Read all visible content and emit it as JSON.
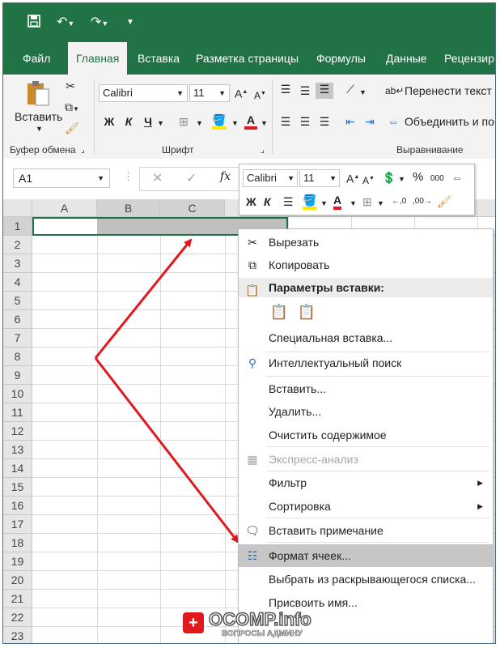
{
  "qat": {
    "save_icon": "save-icon",
    "undo_icon": "undo-icon",
    "redo_icon": "redo-icon"
  },
  "tabs": [
    "Файл",
    "Главная",
    "Вставка",
    "Разметка страницы",
    "Формулы",
    "Данные",
    "Рецензир"
  ],
  "ribbon": {
    "clipboard": {
      "paste_label": "Вставить",
      "group_label": "Буфер обмена"
    },
    "font": {
      "name": "Calibri",
      "size": "11",
      "bold": "Ж",
      "italic": "К",
      "underline": "Ч",
      "group_label": "Шрифт"
    },
    "alignment": {
      "wrap_text": "Перенести текст",
      "merge": "Объединить и по",
      "group_label": "Выравнивание"
    }
  },
  "formula_bar": {
    "name_box": "A1",
    "fx": "fx"
  },
  "mini_toolbar": {
    "font": "Calibri",
    "size": "11",
    "percent": "%",
    "thousands": "000",
    "bold": "Ж",
    "italic": "К"
  },
  "columns": [
    "A",
    "B",
    "C"
  ],
  "rows": [
    "1",
    "2",
    "3",
    "4",
    "5",
    "6",
    "7",
    "8",
    "9",
    "10",
    "11",
    "12",
    "13",
    "14",
    "15",
    "16",
    "17",
    "18",
    "19",
    "20",
    "21",
    "22",
    "23"
  ],
  "context_menu": {
    "cut": "Вырезать",
    "copy": "Копировать",
    "paste_options": "Параметры вставки:",
    "paste_special": "Специальная вставка...",
    "smart_lookup": "Интеллектуальный поиск",
    "insert": "Вставить...",
    "delete": "Удалить...",
    "clear": "Очистить содержимое",
    "quick_analysis": "Экспресс-анализ",
    "filter": "Фильтр",
    "sort": "Сортировка",
    "insert_comment": "Вставить примечание",
    "format_cells": "Формат ячеек...",
    "pick_list": "Выбрать из раскрывающегося списка...",
    "define_name": "Присвоить имя..."
  },
  "watermark": {
    "text": "OCOMP.info",
    "sub": "ВОПРОСЫ АДМИНУ"
  },
  "colors": {
    "excel_green": "#217346",
    "arrow_red": "#e0191e",
    "highlight": "#c6c6c6"
  }
}
